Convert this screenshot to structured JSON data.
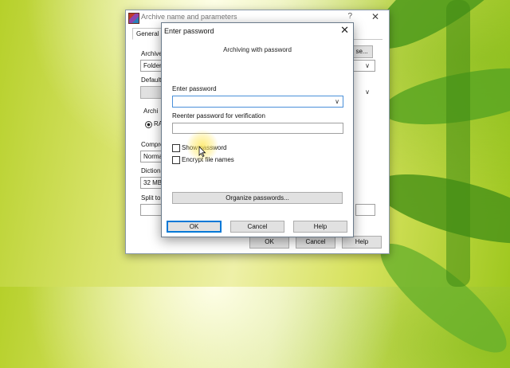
{
  "background": {
    "accent": "#b6d02a"
  },
  "back_window": {
    "title": "Archive name and parameters",
    "help_glyph": "?",
    "close_glyph": "✕",
    "tab_general": "General",
    "archive_label": "Archive",
    "archive_value": "Folder",
    "browse_label": "se...",
    "default_label": "Default",
    "archive_format_label": "Archi",
    "radio_rar_label": "RA",
    "compression_label": "Compre",
    "compression_value": "Normal",
    "dictionary_label": "Dictiona",
    "dictionary_value": "32 MB",
    "split_label": "Split to",
    "ok": "OK",
    "cancel": "Cancel",
    "help": "Help"
  },
  "dialog": {
    "title": "Enter password",
    "close_glyph": "✕",
    "subtitle": "Archiving with password",
    "enter_password_label": "Enter password",
    "enter_password_value": "",
    "reenter_label": "Reenter password for verification",
    "reenter_value": "",
    "show_password_label": "Show password",
    "show_password_checked": false,
    "encrypt_names_label": "Encrypt file names",
    "encrypt_names_checked": false,
    "organize_button": "Organize passwords...",
    "ok": "OK",
    "cancel": "Cancel",
    "help": "Help",
    "dropdown_glyph": "∨"
  }
}
